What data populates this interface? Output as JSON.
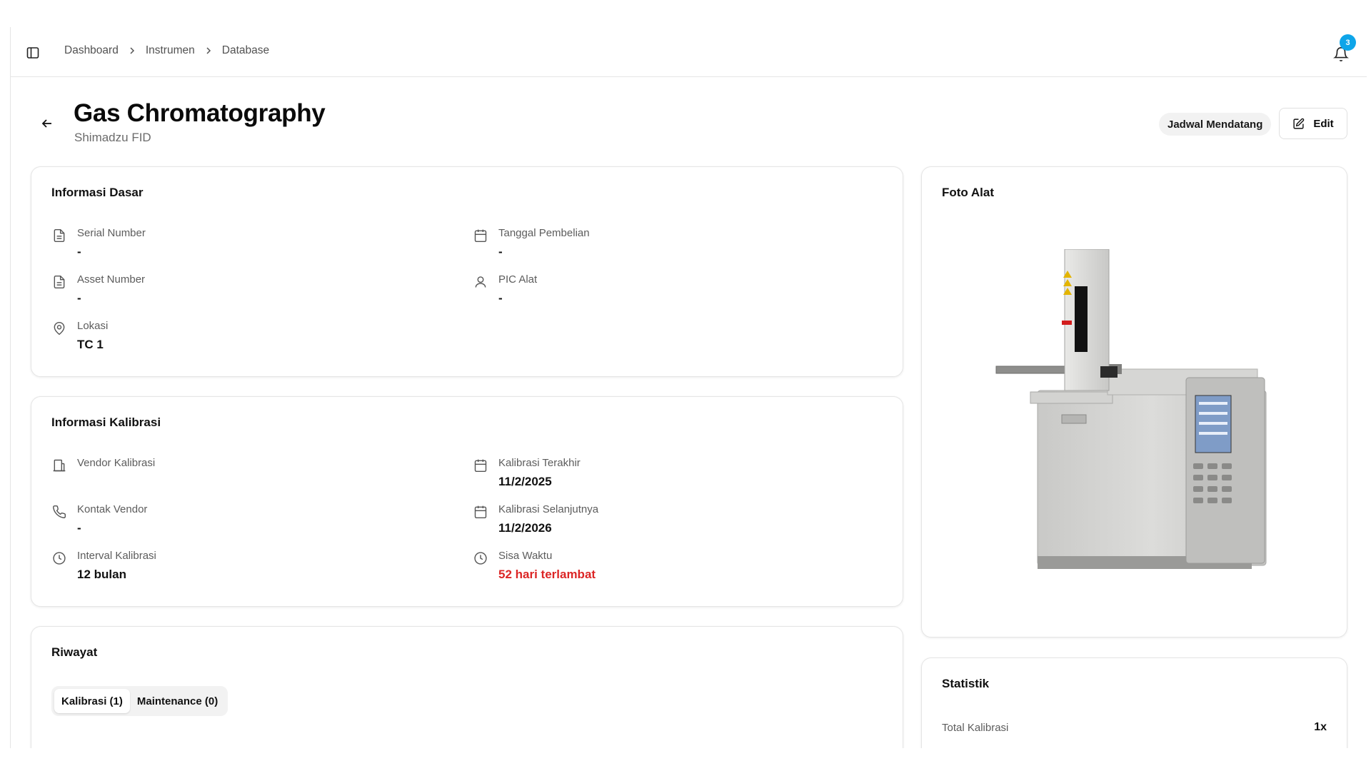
{
  "breadcrumb": [
    "Dashboard",
    "Instrumen",
    "Database"
  ],
  "notifications": {
    "count": "3"
  },
  "header": {
    "title": "Gas Chromatography",
    "subtitle": "Shimadzu FID",
    "schedule_badge": "Jadwal Mendatang",
    "edit_label": "Edit"
  },
  "basic_info": {
    "title": "Informasi Dasar",
    "serial_number": {
      "label": "Serial Number",
      "value": "-"
    },
    "purchase_date": {
      "label": "Tanggal Pembelian",
      "value": "-"
    },
    "asset_number": {
      "label": "Asset Number",
      "value": "-"
    },
    "pic": {
      "label": "PIC Alat",
      "value": "-"
    },
    "location": {
      "label": "Lokasi",
      "value": "TC 1"
    }
  },
  "calibration_info": {
    "title": "Informasi Kalibrasi",
    "vendor": {
      "label": "Vendor Kalibrasi",
      "value": ""
    },
    "last_calibration": {
      "label": "Kalibrasi Terakhir",
      "value": "11/2/2025"
    },
    "vendor_contact": {
      "label": "Kontak Vendor",
      "value": "-"
    },
    "next_calibration": {
      "label": "Kalibrasi Selanjutnya",
      "value": "11/2/2026"
    },
    "interval": {
      "label": "Interval Kalibrasi",
      "value": "12 bulan"
    },
    "remaining": {
      "label": "Sisa Waktu",
      "value": "52 hari terlambat"
    }
  },
  "history": {
    "title": "Riwayat",
    "tabs": [
      "Kalibrasi (1)",
      "Maintenance (0)"
    ],
    "active_tab": "Kalibrasi (1)"
  },
  "photo": {
    "title": "Foto Alat"
  },
  "stats": {
    "title": "Statistik",
    "total_calibration": {
      "label": "Total Kalibrasi",
      "value": "1x"
    }
  },
  "colors": {
    "overdue": "#dc2626",
    "badge": "#0ea5e9"
  }
}
